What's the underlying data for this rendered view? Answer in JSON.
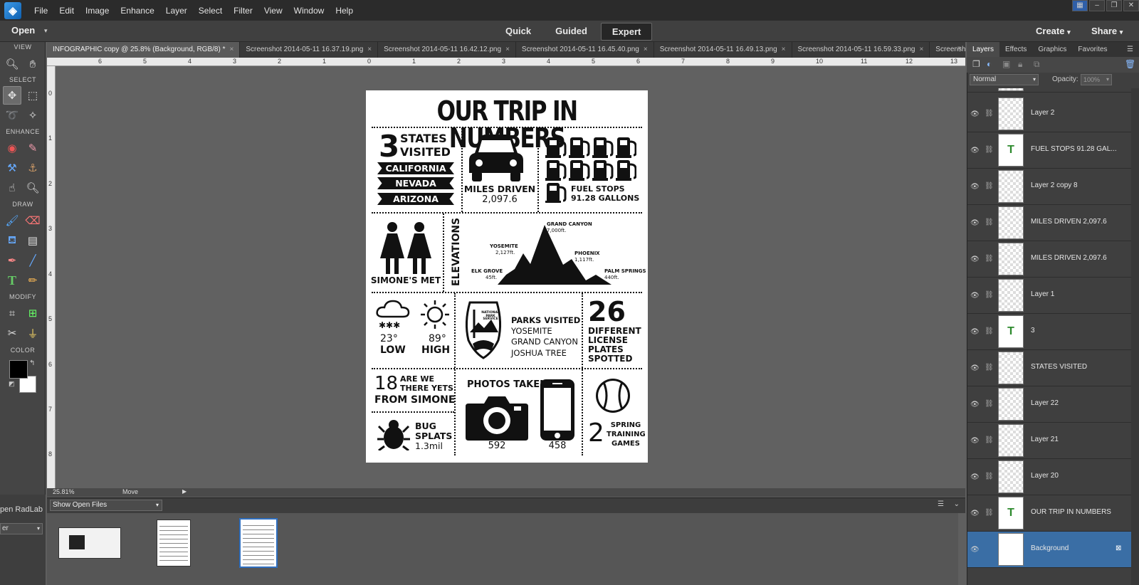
{
  "app": {
    "menu": [
      "File",
      "Edit",
      "Image",
      "Enhance",
      "Layer",
      "Select",
      "Filter",
      "View",
      "Window",
      "Help"
    ]
  },
  "topbar": {
    "open": "Open",
    "modes": [
      "Quick",
      "Guided",
      "Expert"
    ],
    "active_mode": "Expert",
    "create": "Create",
    "share": "Share"
  },
  "toolbox": {
    "sections": [
      "VIEW",
      "SELECT",
      "ENHANCE",
      "DRAW",
      "MODIFY",
      "COLOR"
    ]
  },
  "tabs": [
    "INFOGRAPHIC copy @ 25.8% (Background, RGB/8) *",
    "Screenshot 2014-05-11 16.37.19.png",
    "Screenshot 2014-05-11 16.42.12.png",
    "Screenshot 2014-05-11 16.45.40.png",
    "Screenshot 2014-05-11 16.49.13.png",
    "Screenshot 2014-05-11 16.59.33.png",
    "Screenshot 2014-05-11 17.0"
  ],
  "ruler": {
    "h": [
      "6",
      "5",
      "4",
      "3",
      "2",
      "1",
      "0",
      "1",
      "2",
      "3",
      "4",
      "5",
      "6",
      "7",
      "8",
      "9",
      "10",
      "11",
      "12",
      "13"
    ],
    "v": [
      "0",
      "1",
      "2",
      "3",
      "4",
      "5",
      "6",
      "7",
      "8"
    ]
  },
  "status": {
    "zoom": "25.81%",
    "tool": "Move"
  },
  "bin": {
    "select": "Show Open Files",
    "radlab": "pen RadLab",
    "sel2": "er"
  },
  "infographic": {
    "title": "OUR TRIP IN NUMBERS",
    "states_num": "3",
    "states_text1": "STATES",
    "states_text2": "VISITED",
    "states": [
      "CALIFORNIA",
      "NEVADA",
      "ARIZONA"
    ],
    "miles_label": "MILES DRIVEN",
    "miles_val": "2,097.6",
    "fuel_label": "FUEL STOPS",
    "fuel_val": "91.28 GALLONS",
    "met": "SIMONE'S MET",
    "elevations": "ELEVATIONS",
    "peaks": [
      {
        "name": "GRAND CANYON",
        "alt": "7,000ft."
      },
      {
        "name": "YOSEMITE",
        "alt": "2,127ft."
      },
      {
        "name": "PHOENIX",
        "alt": "1,117ft."
      },
      {
        "name": "ELK GROVE",
        "alt": "45ft."
      },
      {
        "name": "PALM SPRINGS",
        "alt": "440ft."
      }
    ],
    "low_val": "23°",
    "low_label": "LOW",
    "high_val": "89°",
    "high_label": "HIGH",
    "nps": "NATIONAL PARK SERVICE",
    "parks": [
      "PARKS VISITED",
      "YOSEMITE",
      "GRAND CANYON",
      "JOSHUA TREE"
    ],
    "plates_num": "26",
    "plates": [
      "DIFFERENT",
      "LICENSE",
      "PLATES",
      "SPOTTED"
    ],
    "yets_num": "18",
    "yets_a": "ARE WE",
    "yets_b": "THERE YETS",
    "yets_c": "FROM SIMONE",
    "bug": [
      "BUG",
      "SPLATS",
      "1.3mil"
    ],
    "photos_label": "PHOTOS TAKEN",
    "camera_val": "592",
    "phone_val": "458",
    "spring_num": "2",
    "spring": [
      "SPRING",
      "TRAINING",
      "GAMES"
    ]
  },
  "panel": {
    "tabs": [
      "Layers",
      "Effects",
      "Graphics",
      "Favorites"
    ],
    "blend": "Normal",
    "opacity_label": "Opacity:",
    "opacity": "100%",
    "layers": [
      {
        "name": "Layer 2",
        "type": "raster"
      },
      {
        "name": "FUEL STOPS 91.28 GAL...",
        "type": "text"
      },
      {
        "name": "Layer 2 copy 8",
        "type": "raster"
      },
      {
        "name": "MILES DRIVEN 2,097.6",
        "type": "raster"
      },
      {
        "name": "MILES DRIVEN 2,097.6",
        "type": "raster"
      },
      {
        "name": "Layer 1",
        "type": "raster"
      },
      {
        "name": "3",
        "type": "text"
      },
      {
        "name": "STATES  VISITED",
        "type": "raster"
      },
      {
        "name": "Layer 22",
        "type": "raster"
      },
      {
        "name": "Layer 21",
        "type": "raster"
      },
      {
        "name": "Layer 20",
        "type": "raster"
      },
      {
        "name": "OUR TRIP IN NUMBERS",
        "type": "text"
      },
      {
        "name": "Background",
        "type": "background"
      }
    ]
  }
}
